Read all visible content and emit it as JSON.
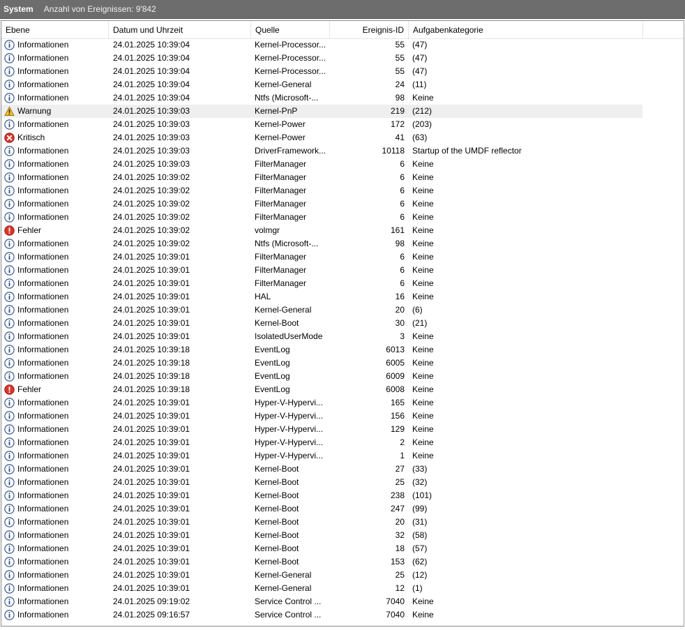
{
  "window": {
    "title": "System",
    "count_label": "Anzahl von Ereignissen: 9'842"
  },
  "columns": {
    "level": "Ebene",
    "date": "Datum und Uhrzeit",
    "source": "Quelle",
    "id": "Ereignis-ID",
    "category": "Aufgabenkategorie"
  },
  "events": [
    {
      "level": "Informationen",
      "icon": "info-icon",
      "date": "24.01.2025 10:39:04",
      "source": "Kernel-Processor...",
      "id": "55",
      "category": "(47)"
    },
    {
      "level": "Informationen",
      "icon": "info-icon",
      "date": "24.01.2025 10:39:04",
      "source": "Kernel-Processor...",
      "id": "55",
      "category": "(47)"
    },
    {
      "level": "Informationen",
      "icon": "info-icon",
      "date": "24.01.2025 10:39:04",
      "source": "Kernel-Processor...",
      "id": "55",
      "category": "(47)"
    },
    {
      "level": "Informationen",
      "icon": "info-icon",
      "date": "24.01.2025 10:39:04",
      "source": "Kernel-General",
      "id": "24",
      "category": "(11)"
    },
    {
      "level": "Informationen",
      "icon": "info-icon",
      "date": "24.01.2025 10:39:04",
      "source": "Ntfs (Microsoft-...",
      "id": "98",
      "category": "Keine"
    },
    {
      "level": "Warnung",
      "icon": "warning-icon",
      "date": "24.01.2025 10:39:03",
      "source": "Kernel-PnP",
      "id": "219",
      "category": "(212)",
      "selected": true
    },
    {
      "level": "Informationen",
      "icon": "info-icon",
      "date": "24.01.2025 10:39:03",
      "source": "Kernel-Power",
      "id": "172",
      "category": "(203)"
    },
    {
      "level": "Kritisch",
      "icon": "critical-icon",
      "date": "24.01.2025 10:39:03",
      "source": "Kernel-Power",
      "id": "41",
      "category": "(63)"
    },
    {
      "level": "Informationen",
      "icon": "info-icon",
      "date": "24.01.2025 10:39:03",
      "source": "DriverFramework...",
      "id": "10118",
      "category": "Startup of the UMDF reflector"
    },
    {
      "level": "Informationen",
      "icon": "info-icon",
      "date": "24.01.2025 10:39:03",
      "source": "FilterManager",
      "id": "6",
      "category": "Keine"
    },
    {
      "level": "Informationen",
      "icon": "info-icon",
      "date": "24.01.2025 10:39:02",
      "source": "FilterManager",
      "id": "6",
      "category": "Keine"
    },
    {
      "level": "Informationen",
      "icon": "info-icon",
      "date": "24.01.2025 10:39:02",
      "source": "FilterManager",
      "id": "6",
      "category": "Keine"
    },
    {
      "level": "Informationen",
      "icon": "info-icon",
      "date": "24.01.2025 10:39:02",
      "source": "FilterManager",
      "id": "6",
      "category": "Keine"
    },
    {
      "level": "Informationen",
      "icon": "info-icon",
      "date": "24.01.2025 10:39:02",
      "source": "FilterManager",
      "id": "6",
      "category": "Keine"
    },
    {
      "level": "Fehler",
      "icon": "error-icon",
      "date": "24.01.2025 10:39:02",
      "source": "volmgr",
      "id": "161",
      "category": "Keine"
    },
    {
      "level": "Informationen",
      "icon": "info-icon",
      "date": "24.01.2025 10:39:02",
      "source": "Ntfs (Microsoft-...",
      "id": "98",
      "category": "Keine"
    },
    {
      "level": "Informationen",
      "icon": "info-icon",
      "date": "24.01.2025 10:39:01",
      "source": "FilterManager",
      "id": "6",
      "category": "Keine"
    },
    {
      "level": "Informationen",
      "icon": "info-icon",
      "date": "24.01.2025 10:39:01",
      "source": "FilterManager",
      "id": "6",
      "category": "Keine"
    },
    {
      "level": "Informationen",
      "icon": "info-icon",
      "date": "24.01.2025 10:39:01",
      "source": "FilterManager",
      "id": "6",
      "category": "Keine"
    },
    {
      "level": "Informationen",
      "icon": "info-icon",
      "date": "24.01.2025 10:39:01",
      "source": "HAL",
      "id": "16",
      "category": "Keine"
    },
    {
      "level": "Informationen",
      "icon": "info-icon",
      "date": "24.01.2025 10:39:01",
      "source": "Kernel-General",
      "id": "20",
      "category": "(6)"
    },
    {
      "level": "Informationen",
      "icon": "info-icon",
      "date": "24.01.2025 10:39:01",
      "source": "Kernel-Boot",
      "id": "30",
      "category": "(21)"
    },
    {
      "level": "Informationen",
      "icon": "info-icon",
      "date": "24.01.2025 10:39:01",
      "source": "IsolatedUserMode",
      "id": "3",
      "category": "Keine"
    },
    {
      "level": "Informationen",
      "icon": "info-icon",
      "date": "24.01.2025 10:39:18",
      "source": "EventLog",
      "id": "6013",
      "category": "Keine"
    },
    {
      "level": "Informationen",
      "icon": "info-icon",
      "date": "24.01.2025 10:39:18",
      "source": "EventLog",
      "id": "6005",
      "category": "Keine"
    },
    {
      "level": "Informationen",
      "icon": "info-icon",
      "date": "24.01.2025 10:39:18",
      "source": "EventLog",
      "id": "6009",
      "category": "Keine"
    },
    {
      "level": "Fehler",
      "icon": "error-icon",
      "date": "24.01.2025 10:39:18",
      "source": "EventLog",
      "id": "6008",
      "category": "Keine"
    },
    {
      "level": "Informationen",
      "icon": "info-icon",
      "date": "24.01.2025 10:39:01",
      "source": "Hyper-V-Hypervi...",
      "id": "165",
      "category": "Keine"
    },
    {
      "level": "Informationen",
      "icon": "info-icon",
      "date": "24.01.2025 10:39:01",
      "source": "Hyper-V-Hypervi...",
      "id": "156",
      "category": "Keine"
    },
    {
      "level": "Informationen",
      "icon": "info-icon",
      "date": "24.01.2025 10:39:01",
      "source": "Hyper-V-Hypervi...",
      "id": "129",
      "category": "Keine"
    },
    {
      "level": "Informationen",
      "icon": "info-icon",
      "date": "24.01.2025 10:39:01",
      "source": "Hyper-V-Hypervi...",
      "id": "2",
      "category": "Keine"
    },
    {
      "level": "Informationen",
      "icon": "info-icon",
      "date": "24.01.2025 10:39:01",
      "source": "Hyper-V-Hypervi...",
      "id": "1",
      "category": "Keine"
    },
    {
      "level": "Informationen",
      "icon": "info-icon",
      "date": "24.01.2025 10:39:01",
      "source": "Kernel-Boot",
      "id": "27",
      "category": "(33)"
    },
    {
      "level": "Informationen",
      "icon": "info-icon",
      "date": "24.01.2025 10:39:01",
      "source": "Kernel-Boot",
      "id": "25",
      "category": "(32)"
    },
    {
      "level": "Informationen",
      "icon": "info-icon",
      "date": "24.01.2025 10:39:01",
      "source": "Kernel-Boot",
      "id": "238",
      "category": "(101)"
    },
    {
      "level": "Informationen",
      "icon": "info-icon",
      "date": "24.01.2025 10:39:01",
      "source": "Kernel-Boot",
      "id": "247",
      "category": "(99)"
    },
    {
      "level": "Informationen",
      "icon": "info-icon",
      "date": "24.01.2025 10:39:01",
      "source": "Kernel-Boot",
      "id": "20",
      "category": "(31)"
    },
    {
      "level": "Informationen",
      "icon": "info-icon",
      "date": "24.01.2025 10:39:01",
      "source": "Kernel-Boot",
      "id": "32",
      "category": "(58)"
    },
    {
      "level": "Informationen",
      "icon": "info-icon",
      "date": "24.01.2025 10:39:01",
      "source": "Kernel-Boot",
      "id": "18",
      "category": "(57)"
    },
    {
      "level": "Informationen",
      "icon": "info-icon",
      "date": "24.01.2025 10:39:01",
      "source": "Kernel-Boot",
      "id": "153",
      "category": "(62)"
    },
    {
      "level": "Informationen",
      "icon": "info-icon",
      "date": "24.01.2025 10:39:01",
      "source": "Kernel-General",
      "id": "25",
      "category": "(12)"
    },
    {
      "level": "Informationen",
      "icon": "info-icon",
      "date": "24.01.2025 10:39:01",
      "source": "Kernel-General",
      "id": "12",
      "category": "(1)"
    },
    {
      "level": "Informationen",
      "icon": "info-icon",
      "date": "24.01.2025 09:19:02",
      "source": "Service Control ...",
      "id": "7040",
      "category": "Keine"
    },
    {
      "level": "Informationen",
      "icon": "info-icon",
      "date": "24.01.2025 09:16:57",
      "source": "Service Control ...",
      "id": "7040",
      "category": "Keine"
    }
  ]
}
